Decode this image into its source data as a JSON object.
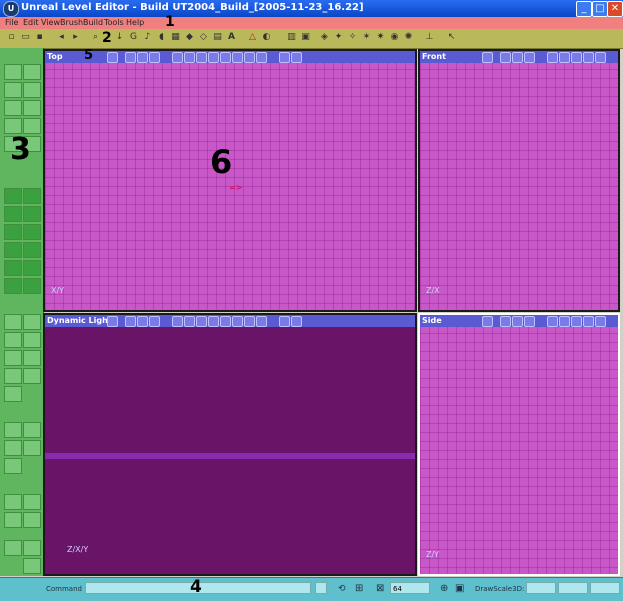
{
  "window": {
    "title": "Unreal Level Editor - Build UT2004_Build_[2005-11-23_16.22]",
    "app_icon": "unreal-logo-icon",
    "min": "_",
    "max": "□",
    "close": "✕"
  },
  "menu": [
    "File",
    "Edit",
    "View",
    "Brush",
    "Build",
    "Tools",
    "Help"
  ],
  "callouts": {
    "menu": "1",
    "toolbar": "2",
    "left_tools": "3",
    "status": "4",
    "viewport_header": "5",
    "viewport": "6"
  },
  "toolbar": {
    "icons": [
      "new-file-icon",
      "open-icon",
      "save-icon",
      "undo-icon",
      "redo-icon",
      "find-actors-icon",
      "actor-browser-icon",
      "group-browser-icon",
      "music-browser-icon",
      "sound-browser-icon",
      "texture-browser-icon",
      "mesh-browser-icon",
      "animation-browser-icon",
      "static-mesh-browser-icon",
      "prefab-browser-icon",
      "text-font-icon",
      "terrain-icon",
      "matinee-icon",
      "2d-shape-editor-icon",
      "build-geometry-icon",
      "build-lighting-icon",
      "build-paths-icon",
      "build-all-icon",
      "play-level-icon",
      "pointer-icon"
    ],
    "text_glyph": "A"
  },
  "viewports": [
    {
      "name": "Top",
      "axis": "X/Y",
      "marker": "=>"
    },
    {
      "name": "Front",
      "axis": "Z/X",
      "marker": ""
    },
    {
      "name": "Dynamic Light",
      "axis": "Z/X/Y",
      "marker": ""
    },
    {
      "name": "Side",
      "axis": "Z/Y",
      "marker": ""
    }
  ],
  "status": {
    "command_label": "Command",
    "command_value": "",
    "grid_value": "64",
    "drawscale_label": "DrawScale3D:",
    "drawscale_x": "",
    "drawscale_y": "",
    "drawscale_z": ""
  }
}
